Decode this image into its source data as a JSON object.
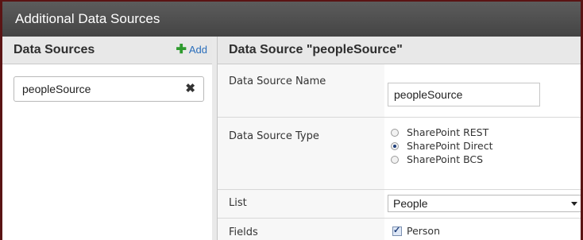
{
  "dialog": {
    "title": "Additional Data Sources"
  },
  "sidebar": {
    "title": "Data Sources",
    "add_label": "Add",
    "items": [
      {
        "label": "peopleSource"
      }
    ]
  },
  "detail": {
    "title": "Data Source \"peopleSource\"",
    "fields": {
      "name": {
        "label": "Data Source Name",
        "value": "peopleSource"
      },
      "type": {
        "label": "Data Source Type",
        "options": [
          "SharePoint REST",
          "SharePoint Direct",
          "SharePoint BCS"
        ],
        "selected": "SharePoint Direct"
      },
      "list": {
        "label": "List",
        "value": "People"
      },
      "fields": {
        "label": "Fields",
        "items": [
          {
            "label": "Person",
            "checked": true
          }
        ]
      }
    }
  },
  "colors": {
    "title_bar": "#4a4a4a",
    "accent_link": "#2a6ebb",
    "add_icon": "#2f9b2f",
    "frame_border": "#5a1414"
  }
}
